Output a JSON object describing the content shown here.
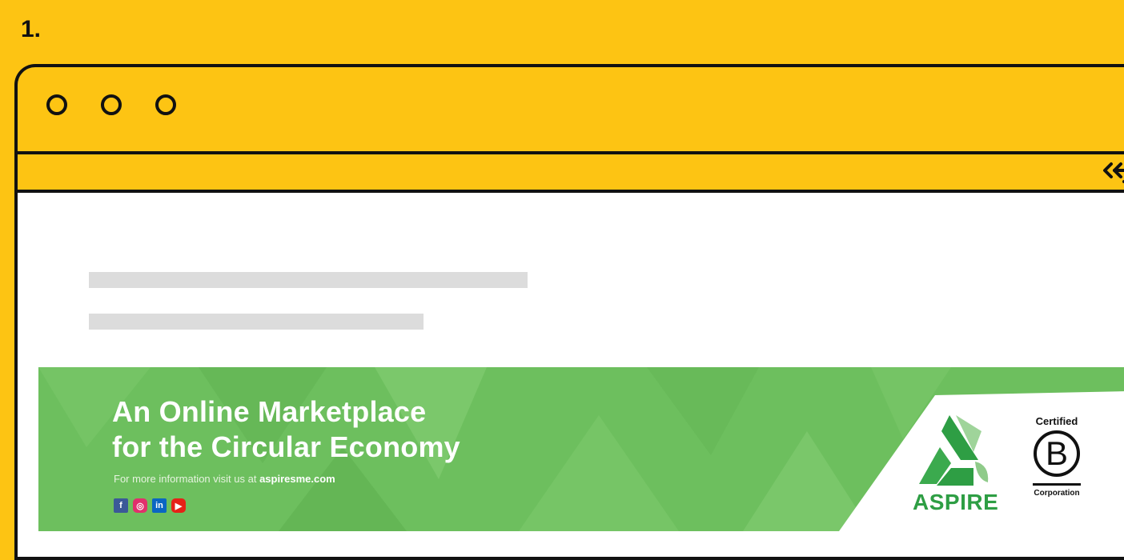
{
  "step": {
    "number": "1."
  },
  "window": {
    "controls": [
      "circle-icon",
      "circle-icon",
      "circle-icon"
    ],
    "share_icon": "share-icon"
  },
  "banner": {
    "headline_line1": "An Online Marketplace",
    "headline_line2": "for the Circular Economy",
    "info_prefix": "For more information visit us at ",
    "info_link": "aspiresme.com",
    "socials": [
      "facebook-icon",
      "instagram-icon",
      "linkedin-icon",
      "youtube-icon"
    ],
    "aspire_logo_text": "ASPIRE",
    "bcorp_top": "Certified",
    "bcorp_letter": "B",
    "bcorp_bottom": "Corporation"
  },
  "colors": {
    "background": "#FDC413",
    "banner_green": "#6DBF5E",
    "aspire_green": "#2E9E44",
    "outline": "#111111"
  }
}
